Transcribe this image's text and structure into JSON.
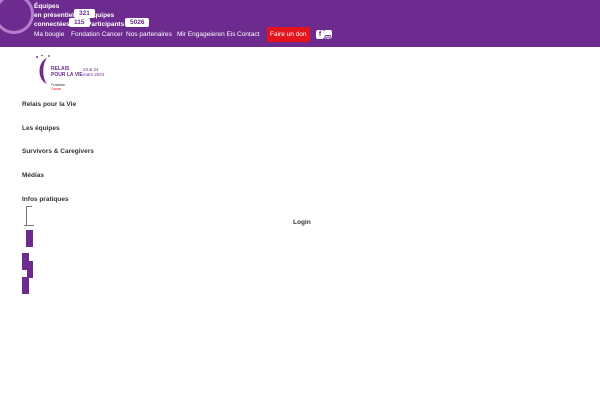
{
  "stats": {
    "equipes_label": "Équipes",
    "presentiel_label": "en présentiel",
    "presentiel_count": "321",
    "equipes2_label": "Équipes",
    "connectees_label": "connectées",
    "connectees_count": "115",
    "participants_label": "Participants",
    "participants_count": "5026"
  },
  "nav": {
    "items": [
      "Ma bougie",
      "Fondation Cancer",
      "Nos partenaires",
      "Mir Engageieren Eis",
      "Contact"
    ],
    "donate": "Faire un don"
  },
  "social": [
    "facebook-icon",
    "instagram-icon"
  ],
  "logo": {
    "line1": "RELAIS",
    "line2": "POUR LA VIE",
    "date1": "23 & 24",
    "date2": "mars 2024",
    "org1": "Fondation",
    "org2": "Cancer"
  },
  "menu": [
    "Relais pour la Vie",
    "Les équipes",
    "Survivors & Caregivers",
    "Médias",
    "Infos pratiques"
  ],
  "login": "Login",
  "colors": {
    "brand": "#6d2b8f",
    "donate": "#e3141c"
  }
}
